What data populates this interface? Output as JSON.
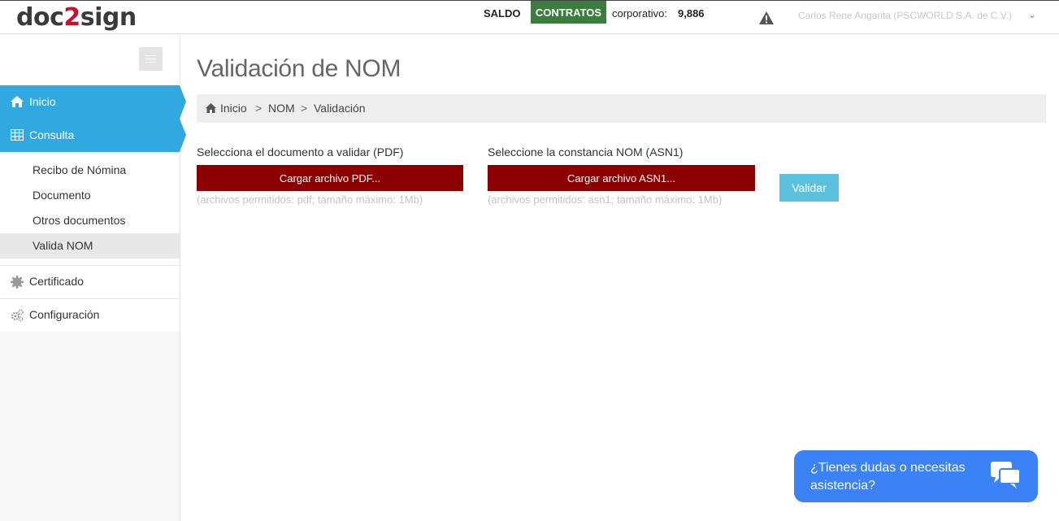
{
  "header": {
    "logo_prefix": "doc",
    "logo_two": "2",
    "logo_suffix": "sign",
    "saldo_label": "SALDO",
    "contratos_label": "CONTRATOS",
    "corporativo_label": "corporativo:",
    "corporativo_value": "9,886",
    "warning_icon": "warning-triangle-icon",
    "user_name": "Carlos Rene Angarita (PSCWORLD S.A. de C.V.)",
    "user_chevron": "⌄"
  },
  "sidebar": {
    "toggle_icon": "hamburger-icon",
    "inicio": {
      "label": "Inicio",
      "icon": "home-icon"
    },
    "consulta": {
      "label": "Consulta",
      "icon": "table-icon"
    },
    "submenu": [
      {
        "label": "Recibo de Nómina"
      },
      {
        "label": "Documento"
      },
      {
        "label": "Otros documentos"
      },
      {
        "label": "Valida NOM"
      }
    ],
    "certificado": {
      "label": "Certificado",
      "icon": "certificate-icon"
    },
    "configuracion": {
      "label": "Configuración",
      "icon": "gears-icon"
    }
  },
  "main": {
    "title": "Validación de NOM",
    "breadcrumb": [
      "Inicio",
      "NOM",
      "Validación"
    ],
    "breadcrumb_sep": ">",
    "pdf": {
      "label": "Selecciona el documento a validar (PDF)",
      "button": "Cargar archivo PDF...",
      "hint": "(archivos permitidos: pdf; tamaño máximo: 1Mb)"
    },
    "asn": {
      "label": "Seleccione la constancia NOM (ASN1)",
      "button": "Cargar archivo ASN1...",
      "hint": "(archivos permitidos: asn1; tamaño máximo: 1Mb)"
    },
    "validar_button": "Validar"
  },
  "chat": {
    "text": "¿Tienes dudas o necesitas asistencia?",
    "icon": "chat-bubbles-icon"
  },
  "colors": {
    "accent_blue": "#31a9e0",
    "upload_red": "#8b0000",
    "contratos_green": "#3c7d3f",
    "validar_cyan": "#5bc0de",
    "chat_blue": "#3b82f6"
  }
}
